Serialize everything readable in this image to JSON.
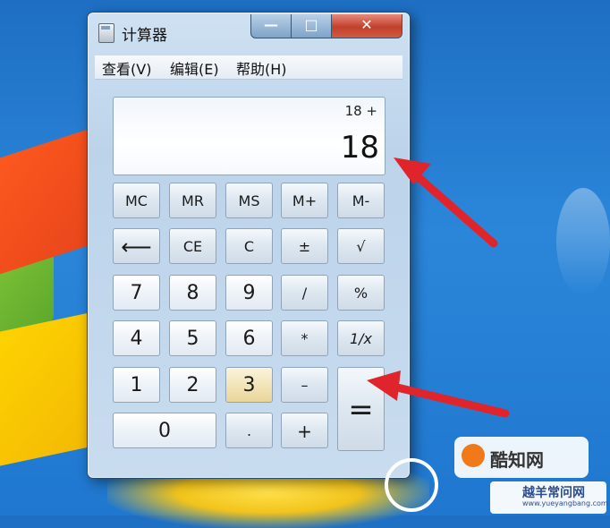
{
  "window": {
    "title": "计算器",
    "controls": {
      "minimize": "—",
      "maximize": "□",
      "close": "✕"
    }
  },
  "menu": {
    "view": "查看(V)",
    "edit": "编辑(E)",
    "help": "帮助(H)"
  },
  "display": {
    "expression": "18  +",
    "value": "18"
  },
  "buttons": {
    "mc": "MC",
    "mr": "MR",
    "ms": "MS",
    "mplus": "M+",
    "mminus": "M-",
    "backspace": "⟵",
    "ce": "CE",
    "c": "C",
    "plusminus": "±",
    "sqrt": "√",
    "d7": "7",
    "d8": "8",
    "d9": "9",
    "div": "/",
    "percent": "%",
    "d4": "4",
    "d5": "5",
    "d6": "6",
    "mul": "*",
    "recip": "1/x",
    "d1": "1",
    "d2": "2",
    "d3": "3",
    "sub": "–",
    "eq": "=",
    "d0": "0",
    "dot": ".",
    "add": "+"
  },
  "watermark": {
    "brand": "酷知网",
    "brand2": "越羊常问网",
    "url": "www.yueyangbang.com"
  },
  "colors": {
    "arrow": "#e0242b",
    "close": "#c0402c"
  }
}
